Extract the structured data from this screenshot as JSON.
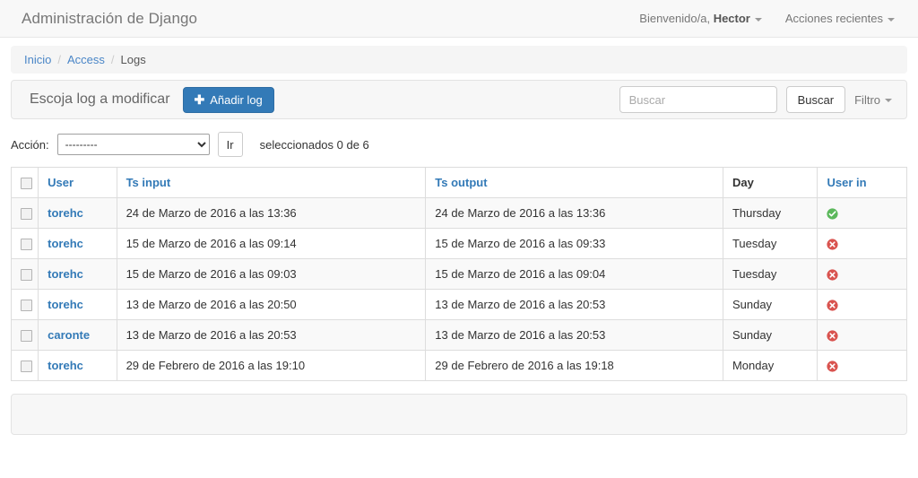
{
  "navbar": {
    "brand": "Administración de Django",
    "welcome_prefix": "Bienvenido/a, ",
    "welcome_user": "Hector",
    "recent_actions": "Acciones recientes"
  },
  "breadcrumb": {
    "home": "Inicio",
    "app": "Access",
    "current": "Logs",
    "separator": "/"
  },
  "panel": {
    "title": "Escoja log a modificar",
    "add_button": "Añadir log",
    "add_icon": "plus-icon",
    "search_placeholder": "Buscar",
    "search_value": "",
    "search_button": "Buscar",
    "filter_label": "Filtro"
  },
  "actions": {
    "label": "Acción:",
    "selected_option": "---------",
    "options": [
      "---------"
    ],
    "go_button": "Ir",
    "selection_count": "seleccionados 0 de 6"
  },
  "table": {
    "columns": [
      {
        "key": "check",
        "label": "",
        "sortable": false
      },
      {
        "key": "user",
        "label": "User",
        "sortable": true
      },
      {
        "key": "tsin",
        "label": "Ts input",
        "sortable": true
      },
      {
        "key": "tsout",
        "label": "Ts output",
        "sortable": true
      },
      {
        "key": "day",
        "label": "Day",
        "sortable": false
      },
      {
        "key": "userin",
        "label": "User in",
        "sortable": true
      }
    ],
    "rows": [
      {
        "user": "torehc",
        "ts_input": "24 de Marzo de 2016 a las 13:36",
        "ts_output": "24 de Marzo de 2016 a las 13:36",
        "day": "Thursday",
        "user_in": true,
        "user_in_icon": "check-circle-icon"
      },
      {
        "user": "torehc",
        "ts_input": "15 de Marzo de 2016 a las 09:14",
        "ts_output": "15 de Marzo de 2016 a las 09:33",
        "day": "Tuesday",
        "user_in": false,
        "user_in_icon": "cross-circle-icon"
      },
      {
        "user": "torehc",
        "ts_input": "15 de Marzo de 2016 a las 09:03",
        "ts_output": "15 de Marzo de 2016 a las 09:04",
        "day": "Tuesday",
        "user_in": false,
        "user_in_icon": "cross-circle-icon"
      },
      {
        "user": "torehc",
        "ts_input": "13 de Marzo de 2016 a las 20:50",
        "ts_output": "13 de Marzo de 2016 a las 20:53",
        "day": "Sunday",
        "user_in": false,
        "user_in_icon": "cross-circle-icon"
      },
      {
        "user": "caronte",
        "ts_input": "13 de Marzo de 2016 a las 20:53",
        "ts_output": "13 de Marzo de 2016 a las 20:53",
        "day": "Sunday",
        "user_in": false,
        "user_in_icon": "cross-circle-icon"
      },
      {
        "user": "torehc",
        "ts_input": "29 de Febrero de 2016 a las 19:10",
        "ts_output": "29 de Febrero de 2016 a las 19:18",
        "day": "Monday",
        "user_in": false,
        "user_in_icon": "cross-circle-icon"
      }
    ]
  },
  "pagination": {
    "text": ""
  },
  "colors": {
    "primary": "#337ab7",
    "link": "#4a86c7",
    "navbar_bg": "#f8f8f8",
    "panel_bg": "#f7f7f7",
    "success": "#5cb85c",
    "danger": "#d9534f",
    "row_stripe": "#f9f9f9",
    "border": "#dddddd"
  }
}
